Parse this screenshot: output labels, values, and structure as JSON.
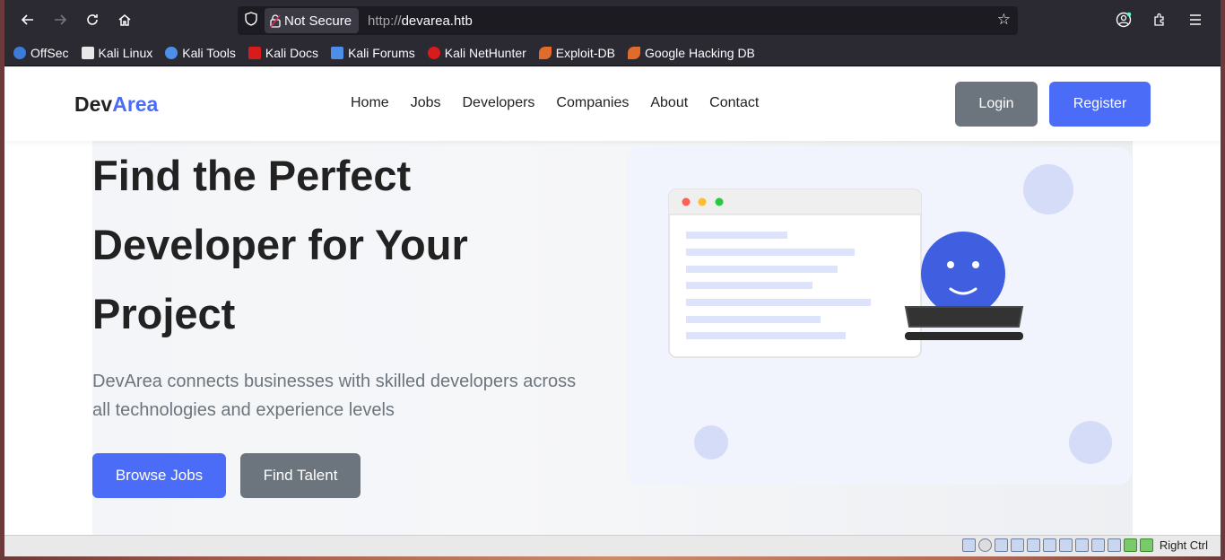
{
  "browser": {
    "security_label": "Not Secure",
    "url_scheme": "http://",
    "url_host": "devarea.htb"
  },
  "bookmarks": [
    {
      "label": "OffSec",
      "color": "#3c7bd9"
    },
    {
      "label": "Kali Linux",
      "color": "#e8e8e8"
    },
    {
      "label": "Kali Tools",
      "color": "#4d8fe8"
    },
    {
      "label": "Kali Docs",
      "color": "#d81b1b"
    },
    {
      "label": "Kali Forums",
      "color": "#4d8fe8"
    },
    {
      "label": "Kali NetHunter",
      "color": "#d81b1b"
    },
    {
      "label": "Exploit-DB",
      "color": "#e06b2b"
    },
    {
      "label": "Google Hacking DB",
      "color": "#e06b2b"
    }
  ],
  "site": {
    "logo_main": "Dev",
    "logo_accent": "Area",
    "nav": [
      "Home",
      "Jobs",
      "Developers",
      "Companies",
      "About",
      "Contact"
    ],
    "login_label": "Login",
    "register_label": "Register",
    "hero_title": "Find the Perfect Developer for Your Project",
    "hero_subtitle": "DevArea connects businesses with skilled developers across all technologies and experience levels",
    "browse_jobs_label": "Browse Jobs",
    "find_talent_label": "Find Talent"
  },
  "statusbar": {
    "host_key": "Right Ctrl"
  },
  "colors": {
    "accent": "#4a6cf7",
    "secondary": "#6c757d",
    "text": "#222222"
  }
}
